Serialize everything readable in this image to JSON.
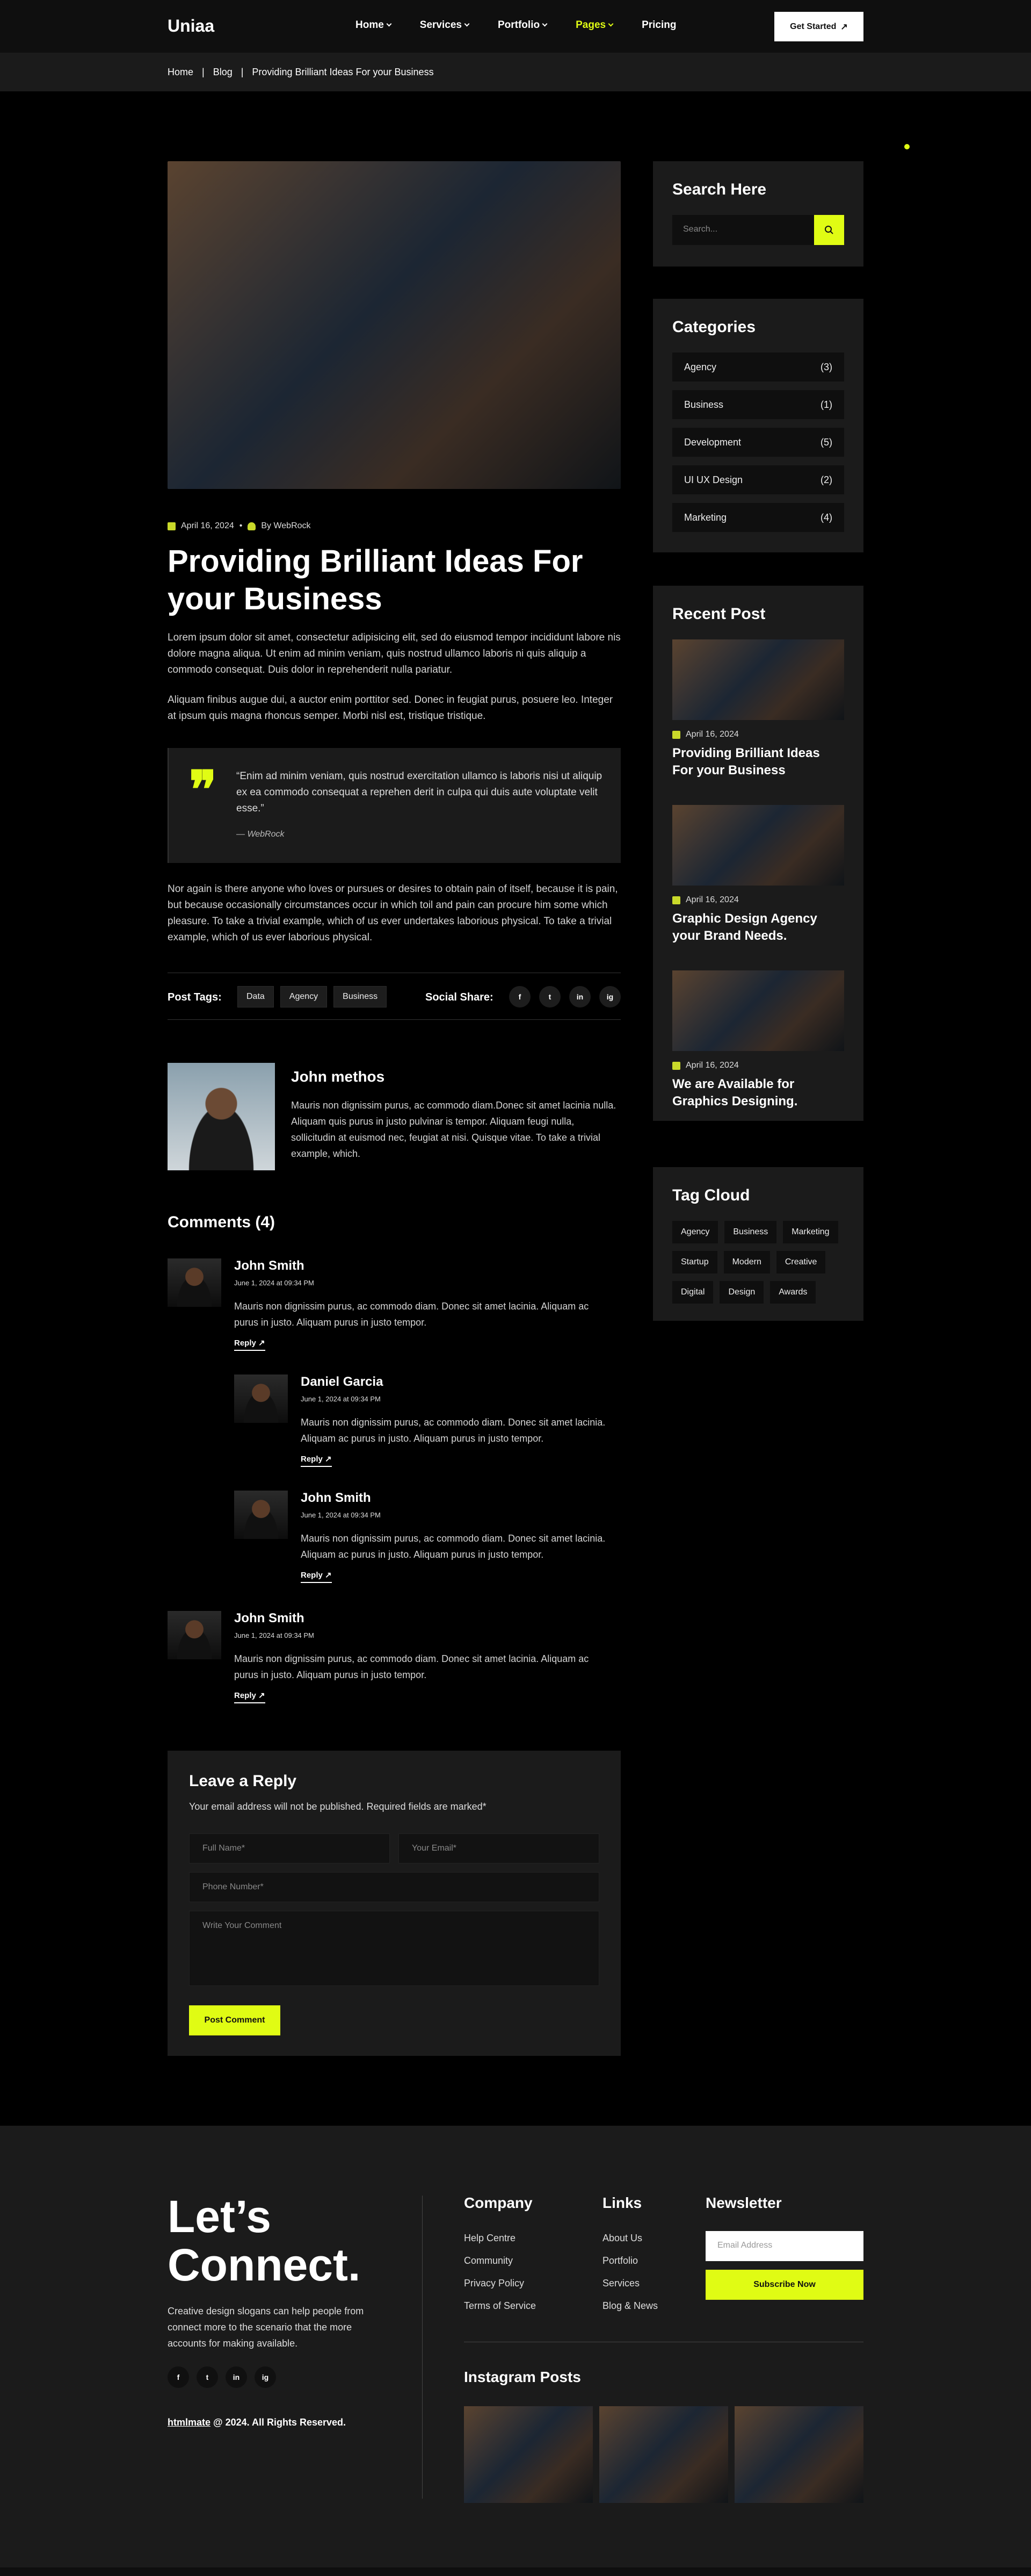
{
  "header": {
    "logo": "Uniaa",
    "nav": [
      {
        "label": "Home",
        "dropdown": true,
        "active": false
      },
      {
        "label": "Services",
        "dropdown": true,
        "active": false
      },
      {
        "label": "Portfolio",
        "dropdown": true,
        "active": false
      },
      {
        "label": "Pages",
        "dropdown": true,
        "active": true
      },
      {
        "label": "Pricing",
        "dropdown": false,
        "active": false
      }
    ],
    "cta": "Get Started"
  },
  "breadcrumb": [
    "Home",
    "Blog",
    "Providing Brilliant Ideas For your Business"
  ],
  "post": {
    "date": "April 16, 2024",
    "author": "By WebRock",
    "title": "Providing Brilliant Ideas For your Business",
    "p1": "Lorem ipsum dolor sit amet, consectetur adipisicing elit, sed do eiusmod tempor incididunt labore nis dolore magna aliqua. Ut enim ad minim veniam, quis nostrud ullamco laboris ni quis aliquip a commodo consequat. Duis dolor in reprehenderit nulla pariatur.",
    "p2": "Aliquam finibus augue dui, a auctor enim porttitor sed. Donec in feugiat purus, posuere leo. Integer at ipsum quis magna rhoncus semper. Morbi nisl est, tristique tristique.",
    "quote": "“Enim ad minim veniam, quis nostrud exercitation ullamco is laboris nisi ut aliquip ex ea commodo consequat a reprehen derit in culpa qui duis aute voluptate velit esse.”",
    "quote_author": "— WebRock",
    "p3": "Nor again is there anyone who loves or pursues or desires to obtain pain of itself, because it is pain, but because occasionally circumstances occur in which toil and pain can procure him some which pleasure. To take a trivial example, which of us ever undertakes laborious physical. To take a trivial example, which of us ever laborious physical.",
    "tags_label": "Post Tags:",
    "tags": [
      "Data",
      "Agency",
      "Business"
    ],
    "share_label": "Social Share:",
    "social": [
      "f",
      "t",
      "in",
      "ig"
    ]
  },
  "author": {
    "name": "John methos",
    "bio": "Mauris non dignissim purus, ac commodo diam.Donec sit amet lacinia nulla. Aliquam quis purus in justo pulvinar is tempor. Aliquam feugi nulla, sollicitudin at euismod nec, feugiat at nisi. Quisque vitae. To take a trivial example, which."
  },
  "comments": {
    "title": "Comments (4)",
    "items": [
      {
        "name": "John Smith",
        "date": "June 1, 2024 at 09:34 PM",
        "text": "Mauris non dignissim purus, ac commodo diam. Donec sit amet lacinia. Aliquam ac purus in justo. Aliquam purus in justo tempor.",
        "reply": "Reply"
      },
      {
        "name": "Daniel Garcia",
        "date": "June 1, 2024 at 09:34 PM",
        "text": "Mauris non dignissim purus, ac commodo diam. Donec sit amet lacinia. Aliquam ac purus in justo. Aliquam purus in justo tempor.",
        "reply": "Reply"
      },
      {
        "name": "John Smith",
        "date": "June 1, 2024 at 09:34 PM",
        "text": "Mauris non dignissim purus, ac commodo diam. Donec sit amet lacinia. Aliquam ac purus in justo. Aliquam purus in justo tempor.",
        "reply": "Reply"
      },
      {
        "name": "John Smith",
        "date": "June 1, 2024 at 09:34 PM",
        "text": "Mauris non dignissim purus, ac commodo diam. Donec sit amet lacinia. Aliquam ac purus in justo. Aliquam purus in justo tempor.",
        "reply": "Reply"
      }
    ]
  },
  "reply_form": {
    "title": "Leave a Reply",
    "subtitle": "Your email address will not be published. Required fields are marked*",
    "full_name": "Full Name*",
    "email": "Your Email*",
    "phone": "Phone Number*",
    "comment": "Write Your Comment",
    "submit": "Post Comment"
  },
  "sidebar": {
    "search_title": "Search Here",
    "search_placeholder": "Search...",
    "categories_title": "Categories",
    "categories": [
      {
        "name": "Agency",
        "count": "(3)"
      },
      {
        "name": "Business",
        "count": "(1)"
      },
      {
        "name": "Development",
        "count": "(5)"
      },
      {
        "name": "UI UX Design",
        "count": "(2)"
      },
      {
        "name": "Marketing",
        "count": "(4)"
      }
    ],
    "recent_title": "Recent Post",
    "recent": [
      {
        "date": "April 16, 2024",
        "title": "Providing Brilliant Ideas For your Business"
      },
      {
        "date": "April 16, 2024",
        "title": "Graphic Design Agency your Brand Needs."
      },
      {
        "date": "April 16, 2024",
        "title": "We are Available for Graphics Designing."
      }
    ],
    "tag_title": "Tag Cloud",
    "tags": [
      "Agency",
      "Business",
      "Marketing",
      "Startup",
      "Modern",
      "Creative",
      "Digital",
      "Design",
      "Awards"
    ]
  },
  "footer": {
    "headline_1": "Let’s",
    "headline_2": "Connect.",
    "desc": "Creative design slogans can help people from connect more to the scenario that the more accounts for making available.",
    "social": [
      "f",
      "t",
      "in",
      "ig"
    ],
    "copy_brand": "htmlmate",
    "copy_rest": " @ 2024. All Rights Reserved.",
    "company_title": "Company",
    "company": [
      "Help Centre",
      "Community",
      "Privacy Policy",
      "Terms of Service"
    ],
    "links_title": "Links",
    "links": [
      "About Us",
      "Portfolio",
      "Services",
      "Blog & News"
    ],
    "newsletter_title": "Newsletter",
    "email_placeholder": "Email Address",
    "subscribe": "Subscribe Now",
    "instagram_title": "Instagram Posts"
  },
  "colors": {
    "accent": "#e0fc14",
    "bg": "#000000",
    "panel": "#1b1b1b"
  }
}
